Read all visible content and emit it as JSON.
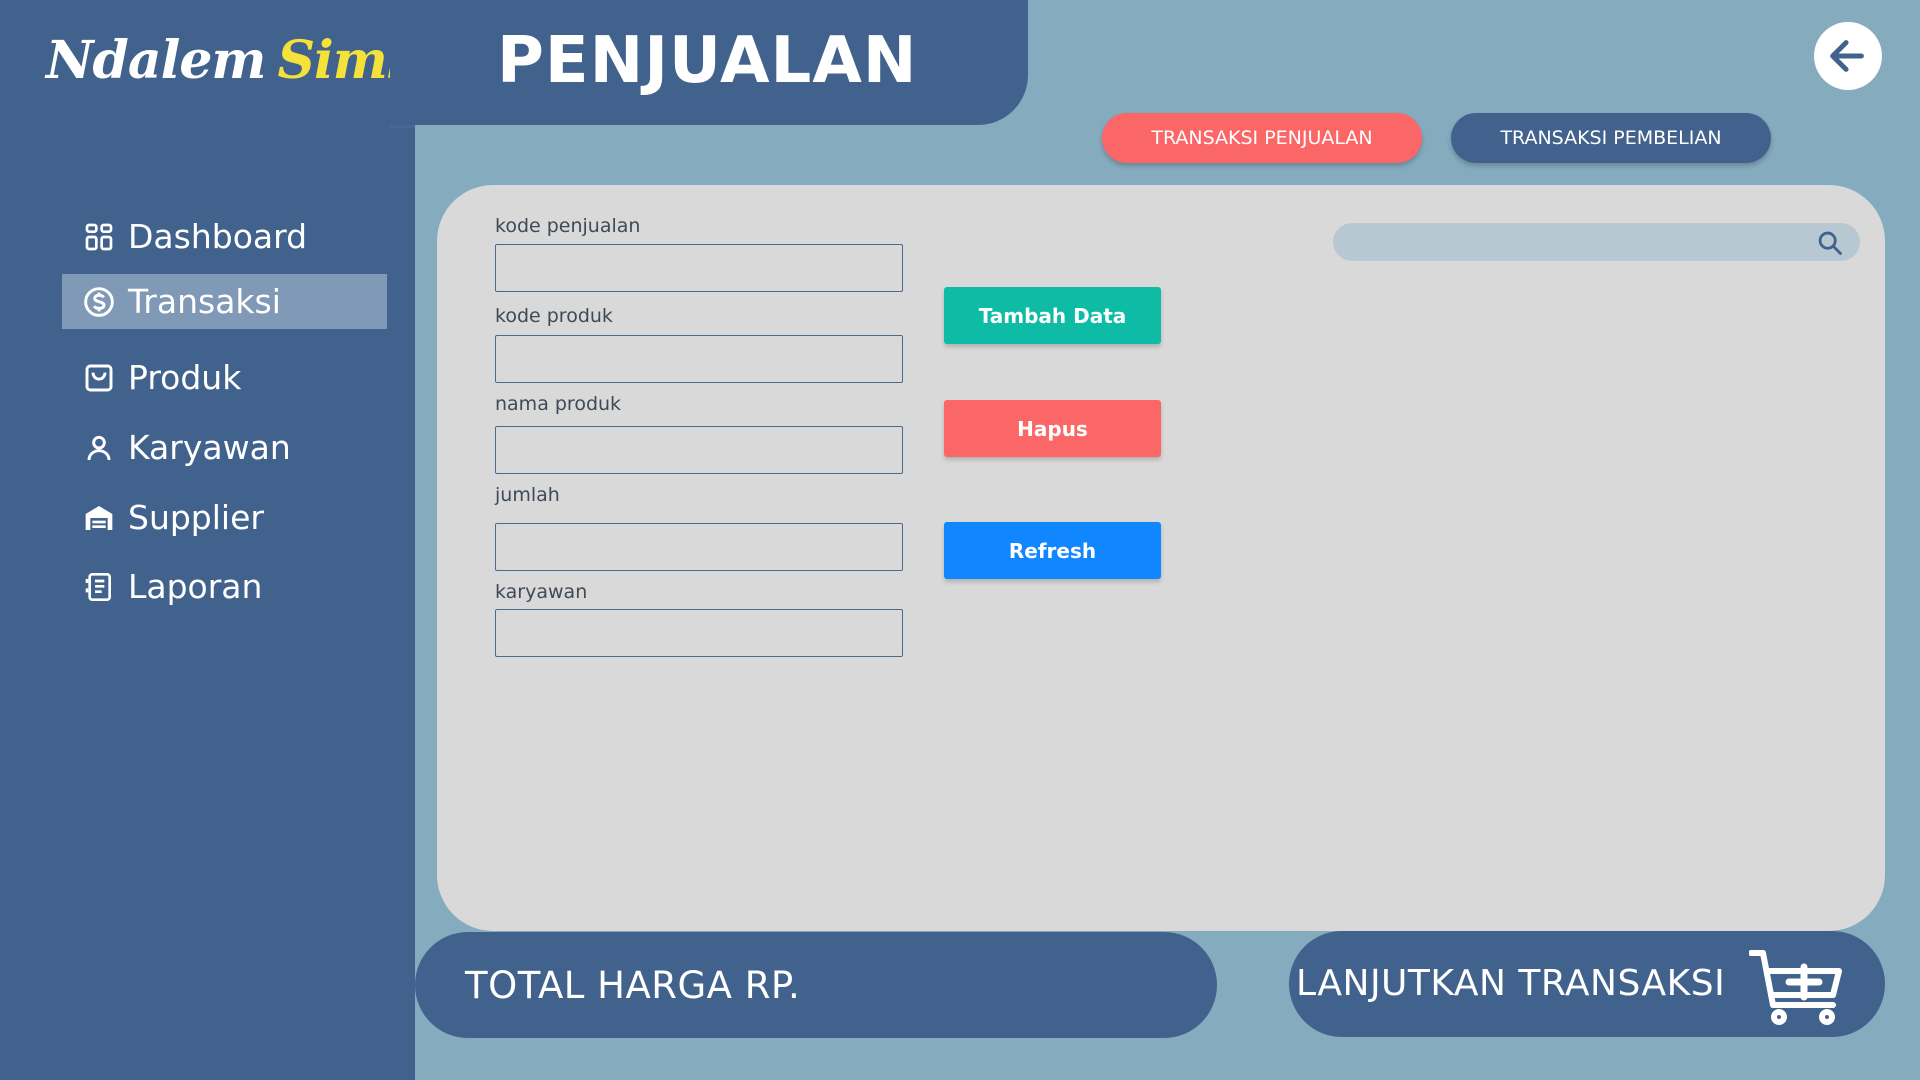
{
  "brand": {
    "word1": "Ndalem",
    "word2": "Simbah"
  },
  "page_title": "PENJUALAN",
  "sidebar": {
    "items": [
      {
        "label": "Dashboard",
        "icon": "dashboard-icon",
        "active": false
      },
      {
        "label": "Transaksi",
        "icon": "dollar-circle-icon",
        "active": true
      },
      {
        "label": "Produk",
        "icon": "shopping-bag-icon",
        "active": false
      },
      {
        "label": "Karyawan",
        "icon": "user-icon",
        "active": false
      },
      {
        "label": "Supplier",
        "icon": "warehouse-icon",
        "active": false
      },
      {
        "label": "Laporan",
        "icon": "report-icon",
        "active": false
      }
    ]
  },
  "tabs": {
    "penjualan": "TRANSAKSI PENJUALAN",
    "pembelian": "TRANSAKSI PEMBELIAN"
  },
  "form": {
    "kode_penjualan": {
      "label": "kode penjualan",
      "value": ""
    },
    "kode_produk": {
      "label": "kode produk",
      "value": ""
    },
    "nama_produk": {
      "label": "nama produk",
      "value": ""
    },
    "jumlah": {
      "label": "jumlah",
      "value": ""
    },
    "karyawan": {
      "label": "karyawan",
      "value": ""
    }
  },
  "actions": {
    "tambah": "Tambah Data",
    "hapus": "Hapus",
    "refresh": "Refresh"
  },
  "search": {
    "value": "",
    "icon": "search-icon"
  },
  "footer": {
    "total_label": "TOTAL HARGA RP.",
    "lanjut_label": "LANJUTKAN TRANSAKSI",
    "cart_icon": "cart-add-icon"
  },
  "colors": {
    "background": "#84abbe",
    "navy": "#42628e",
    "active_item": "#8099b7",
    "card": "#d9d9d9",
    "red": "#fb6767",
    "teal": "#0ebca6",
    "blue": "#1187ff",
    "brand_yellow": "#f4e23a"
  }
}
